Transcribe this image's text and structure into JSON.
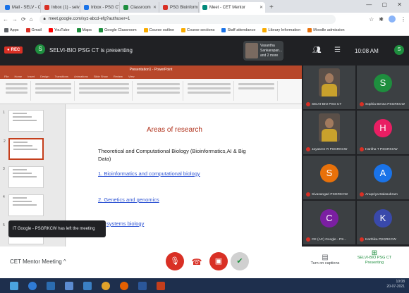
{
  "browser": {
    "tabs": [
      {
        "label": "Mail - SELV - Outlook",
        "color": "#1a73e8"
      },
      {
        "label": "Inbox (1) - selvi@",
        "color": "#d93025"
      },
      {
        "label": "Inbox - PSG CT",
        "color": "#1a73e8"
      },
      {
        "label": "Classroom",
        "color": "#1e8e3e"
      },
      {
        "label": "PSG Bioinformatics",
        "color": "#d93025"
      },
      {
        "label": "Meet - CET Mentor",
        "color": "#00897b"
      }
    ],
    "active_tab": "Meet - CET Mentor",
    "url": "meet.google.com/xyz-abcd-efg?authuser=1",
    "bookmarks": [
      "Apps",
      "Gmail",
      "YouTube",
      "Maps",
      "Google Classroom",
      "Course outline",
      "Course sections",
      "Staff attendance",
      "Library Information",
      "Moodle admission"
    ]
  },
  "meet": {
    "rec_label": "REC",
    "presenter_initial": "S",
    "presenting_text": "SELVI-BIO PSG CT is presenting",
    "presenter_pill": "Vasantha Sankarapan... and 2 more",
    "time": "10:08 AM",
    "user_initial": "S",
    "toast": "IT Google - PSGRKCW has left the meeting",
    "meeting_name": "CET Mentor Meeting",
    "captions_label": "Turn on captions",
    "presenting_now_label": "SELVI-BIO PSG CT Presenting",
    "participants": [
      {
        "name": "SELVI-BIO PSG CT",
        "initial": "",
        "color": "#3c4043",
        "photo": true
      },
      {
        "name": "Sophia Bensa PSGRKCW",
        "initial": "S",
        "color": "#1e8e3e",
        "photo": false
      },
      {
        "name": "Jayasree R PSGRKCW",
        "initial": "",
        "color": "#3c4043",
        "photo": true
      },
      {
        "name": "Haritha T PSGRKCW",
        "initial": "H",
        "color": "#e91e63",
        "photo": false
      },
      {
        "name": "Sivasangari PSGRKCW",
        "initial": "S",
        "color": "#e8710a",
        "photo": false
      },
      {
        "name": "Anupriya Balasubram",
        "initial": "A",
        "color": "#1a73e8",
        "photo": false
      },
      {
        "name": "CE (AC) Google - PS...",
        "initial": "C",
        "color": "#7b1fa2",
        "photo": false
      },
      {
        "name": "Karthika PSGRKCW",
        "initial": "K",
        "color": "#3949ab",
        "photo": false
      }
    ]
  },
  "ppt": {
    "title": "Presentation1 - PowerPoint",
    "ribbon_tabs": [
      "File",
      "Home",
      "Insert",
      "Design",
      "Transitions",
      "Animations",
      "Slide Show",
      "Review",
      "View"
    ],
    "slide_numbers": [
      "1",
      "2",
      "3",
      "4",
      "5"
    ]
  },
  "slide": {
    "title": "Areas of research",
    "intro": "Theoretical and Computational Biology (Bioinformatics,AI & Big Data)",
    "link1": "1. Bioinformatics and computational biology",
    "link2": "2. Genetics and genomics",
    "link3": "systems biology"
  },
  "taskbar": {
    "time": "10:08",
    "date": "20-07-2021"
  }
}
